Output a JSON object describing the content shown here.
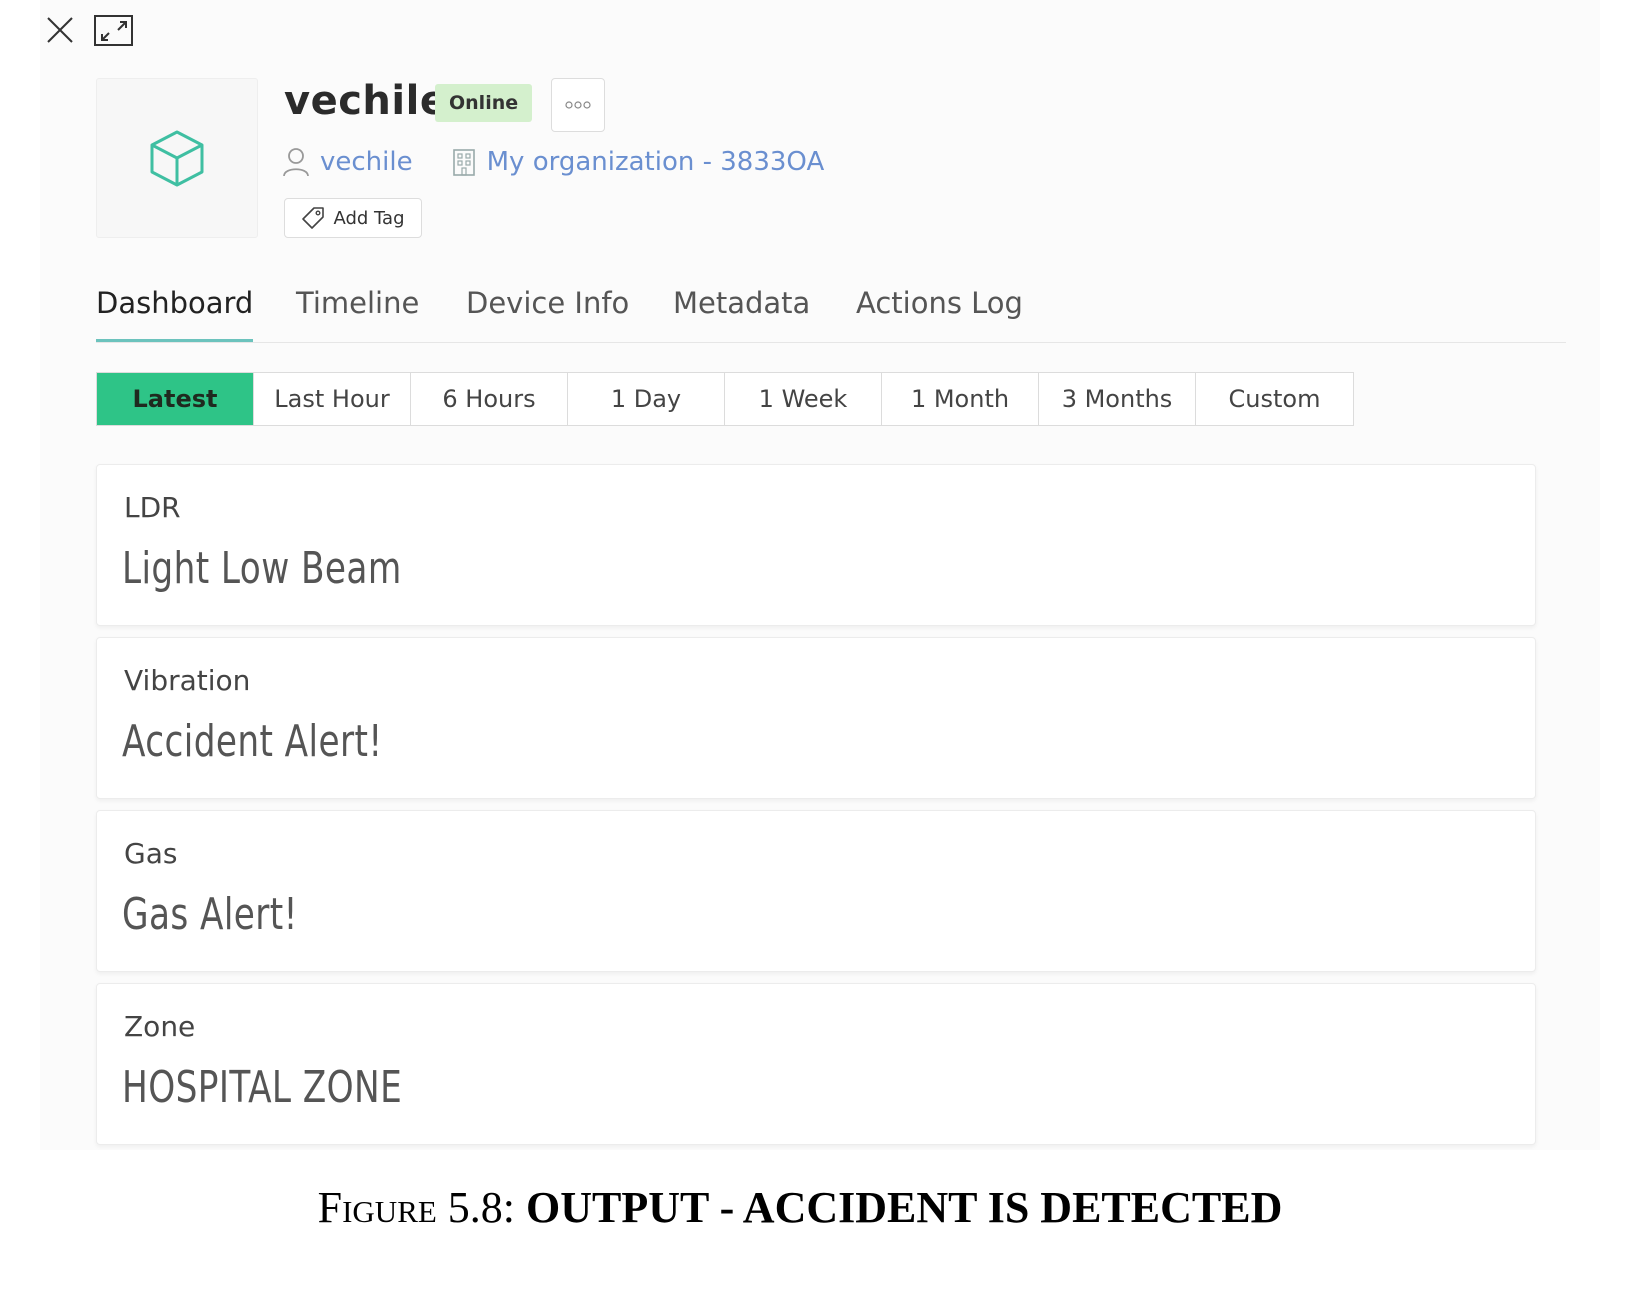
{
  "device": {
    "name": "vechile",
    "status": "Online",
    "owner": "vechile",
    "organization": "My organization - 3833OA",
    "add_tag_label": "Add Tag"
  },
  "tabs": [
    {
      "label": "Dashboard",
      "active": true
    },
    {
      "label": "Timeline"
    },
    {
      "label": "Device Info"
    },
    {
      "label": "Metadata"
    },
    {
      "label": "Actions Log"
    }
  ],
  "time_ranges": [
    "Latest",
    "Last Hour",
    "6 Hours",
    "1 Day",
    "1 Week",
    "1 Month",
    "3 Months",
    "Custom"
  ],
  "widgets": [
    {
      "label": "LDR",
      "value": "Light Low Beam"
    },
    {
      "label": "Vibration",
      "value": "Accident Alert!"
    },
    {
      "label": "Gas",
      "value": "Gas Alert!"
    },
    {
      "label": "Zone",
      "value": "HOSPITAL ZONE"
    }
  ],
  "caption": {
    "figure": "Figure 5.8:",
    "title": "OUTPUT - ACCIDENT IS DETECTED"
  },
  "colors": {
    "accent": "#2ec487",
    "status_bg": "#d4f0cd",
    "link": "#6a8fd0",
    "device_icon": "#3fbfa2"
  },
  "icons": {
    "close": "close-icon",
    "expand": "expand-icon",
    "device": "cube-icon",
    "more": "more-dots-icon",
    "owner": "user-icon",
    "organization": "building-icon",
    "tag": "tag-icon"
  }
}
